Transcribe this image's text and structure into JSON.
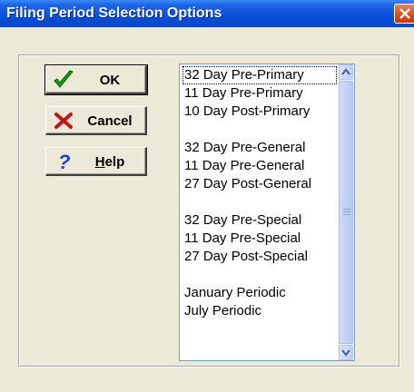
{
  "window": {
    "title": "Filing Period Selection Options",
    "titlebar_color": "#0a4fd8",
    "close_color": "#d8501e"
  },
  "buttons": {
    "ok": {
      "label": "OK",
      "icon": "checkmark-icon"
    },
    "cancel": {
      "label": "Cancel",
      "icon": "x-icon"
    },
    "help": {
      "label": "Help",
      "icon": "question-icon",
      "mnemonic": "H"
    }
  },
  "list": {
    "items": [
      "32 Day Pre-Primary",
      "11 Day Pre-Primary",
      "10 Day Post-Primary",
      "",
      "32 Day Pre-General",
      "11 Day Pre-General",
      "27 Day Post-General",
      "",
      "32 Day Pre-Special",
      "11 Day Pre-Special",
      "27 Day Post-Special",
      "",
      "January Periodic",
      "July Periodic"
    ],
    "focused_index": 0
  }
}
